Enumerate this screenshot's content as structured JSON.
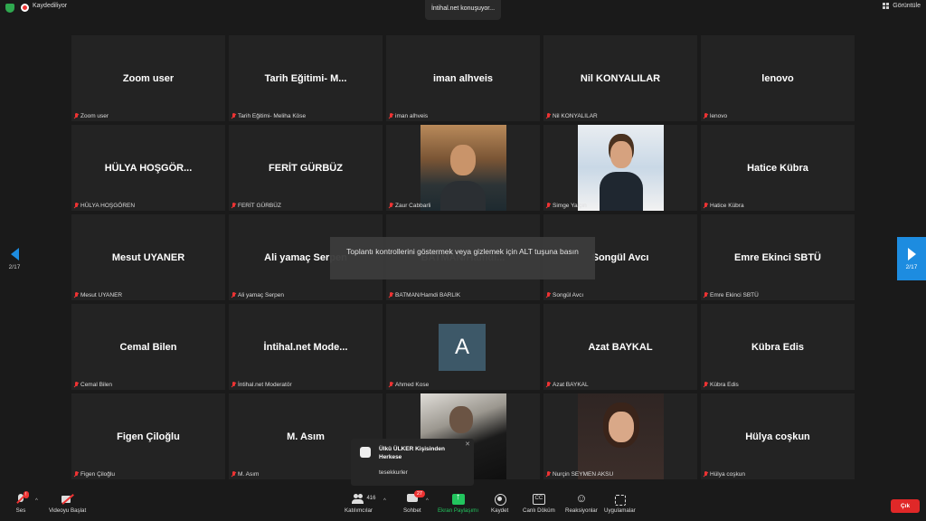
{
  "topbar": {
    "recording_label": "Kaydediliyor",
    "speaking_label": "İntihal.net konuşuyor...",
    "view_label": "Görüntüle"
  },
  "navigation": {
    "left_page": "2/17",
    "right_page": "2/17"
  },
  "participants": [
    {
      "display": "Zoom user",
      "name": "Zoom user",
      "video": null
    },
    {
      "display": "Tarih Eğitimi- M...",
      "name": "Tarih Eğitimi- Meliha Köse",
      "video": null
    },
    {
      "display": "iman alhveis",
      "name": "iman alhveis",
      "video": null
    },
    {
      "display": "Nil KONYALILAR",
      "name": "Nil KONYALILAR",
      "video": null
    },
    {
      "display": "lenovo",
      "name": "lenovo",
      "video": null
    },
    {
      "display": "HÜLYA HOŞGÖR...",
      "name": "HÜLYA HOŞGÖREN",
      "video": null
    },
    {
      "display": "FERİT GÜRBÜZ",
      "name": "FERİT GÜRBÜZ",
      "video": null
    },
    {
      "display": "",
      "name": "Zaur Cabbarli",
      "video": "face-m"
    },
    {
      "display": "",
      "name": "Simge Yalçın",
      "video": "face-f"
    },
    {
      "display": "Hatice Kübra",
      "name": "Hatice Kübra",
      "video": null
    },
    {
      "display": "Mesut UYANER",
      "name": "Mesut UYANER",
      "video": null
    },
    {
      "display": "Ali yamaç Serpen",
      "name": "Ali yamaç Serpen",
      "video": null
    },
    {
      "display": "BATMAN/Hamdi...",
      "name": "BATMAN/Hamdi BARLIK",
      "video": null
    },
    {
      "display": "Songül Avcı",
      "name": "Songül Avcı",
      "video": null
    },
    {
      "display": "Emre Ekinci SBTÜ",
      "name": "Emre Ekinci SBTÜ",
      "video": null
    },
    {
      "display": "Cemal Bilen",
      "name": "Cemal Bilen",
      "video": null
    },
    {
      "display": "İntihal.net Mode...",
      "name": "İntihal.net Moderatör",
      "video": null
    },
    {
      "display": "",
      "name": "Ahmed Kose",
      "video": "avatar",
      "avatar_letter": "A"
    },
    {
      "display": "Azat BAYKAL",
      "name": "Azat BAYKAL",
      "video": null
    },
    {
      "display": "Kübra Edis",
      "name": "Kübra Edis",
      "video": null
    },
    {
      "display": "Figen Çiloğlu",
      "name": "Figen Çiloğlu",
      "video": null
    },
    {
      "display": "M. Asım",
      "name": "M. Asım",
      "video": null
    },
    {
      "display": "",
      "name": "",
      "video": "face-dark"
    },
    {
      "display": "",
      "name": "Nurçin SEYMEN AKSU",
      "video": "face-g"
    },
    {
      "display": "Hülya coşkun",
      "name": "Hülya coşkun",
      "video": null
    }
  ],
  "overlay_hint": "Toplantı kontrollerini göstermek veya gizlemek için ALT tuşuna basın",
  "chat_popup": {
    "sender": "Ülkü ÜLKER Kişisinden Herkese",
    "message": "tesekkurler"
  },
  "toolbar": {
    "audio_label": "Ses",
    "video_label": "Videoyu Başlat",
    "participants_label": "Katılımcılar",
    "participants_count": "416",
    "chat_label": "Sohbet",
    "chat_badge": "27",
    "share_label": "Ekran Paylaşımı",
    "record_label": "Kaydet",
    "cc_label": "Canlı Döküm",
    "cc_icon_text": "CC",
    "reactions_label": "Reaksiyonlar",
    "apps_label": "Uygulamalar",
    "leave_label": "Çık"
  },
  "colors": {
    "share_accent": "#22c55e",
    "leave": "#e02828",
    "nav_accent": "#1d8ce0"
  }
}
